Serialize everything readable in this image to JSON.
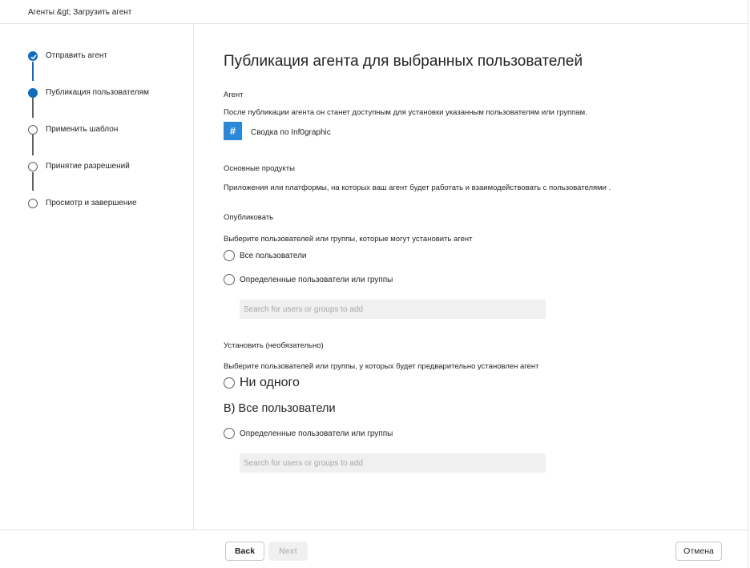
{
  "breadcrumb": "Агенты &gt; Загрузить агент",
  "steps": [
    {
      "label": "Отправить агент",
      "state": "done"
    },
    {
      "label": "Публикация пользователям",
      "state": "current"
    },
    {
      "label": "Применить шаблон",
      "state": "pending"
    },
    {
      "label": "Принятие разрешений",
      "state": "pending"
    },
    {
      "label": "Просмотр и завершение",
      "state": "pending"
    }
  ],
  "main": {
    "title": "Публикация агента для выбранных пользователей",
    "agent": {
      "heading": "Агент",
      "description": "После публикации агента он станет доступным для установки указанным пользователям или группам.",
      "icon_glyph": "#",
      "name": "Сводка по Inf0graphic"
    },
    "products": {
      "heading": "Основные продукты",
      "description": "Приложения или платформы, на которых ваш агент будет работать и взаимодействовать с пользователями ."
    },
    "publish": {
      "heading": "Опубликовать",
      "description": "Выберите пользователей или группы, которые могут установить агент",
      "options": [
        "Все пользователи",
        "Определенные пользователи или группы"
      ],
      "search_placeholder": "Search for users or groups to add"
    },
    "install": {
      "heading": "Установить (необязательно)",
      "description": "Выберите пользователей или группы, у которых будет предварительно установлен агент",
      "option_none": "Ни одного",
      "option_all": "B) Все пользователи",
      "option_specific": "Определенные пользователи или группы",
      "search_placeholder": "Search for users or groups to add"
    }
  },
  "footer": {
    "back": "Back",
    "next": "Next",
    "cancel": "Отмена"
  },
  "colors": {
    "accent": "#0f6cbd",
    "agent_icon": "#2b88d8"
  }
}
